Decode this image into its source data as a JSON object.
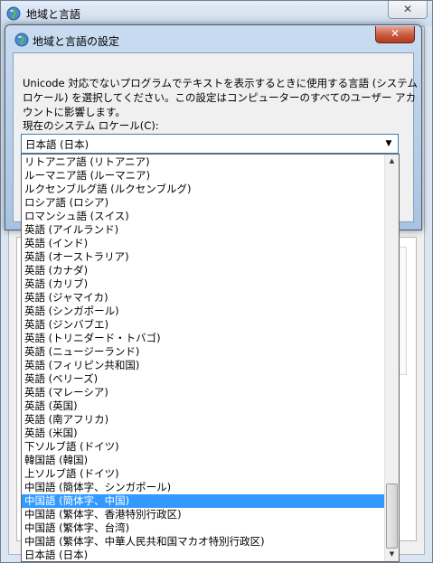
{
  "outer_window": {
    "title": "地域と言語",
    "close_label": "✕"
  },
  "dialog": {
    "title": "地域と言語の設定",
    "close_label": "✕",
    "description": "Unicode 対応でないプログラムでテキストを表示するときに使用する言語 (システム ロケール) を選択してください。この設定はコンピューターのすべてのユーザー アカウントに影響します。",
    "locale_label": "現在のシステム ロケール(C):",
    "selected_locale": "日本語 (日本)"
  },
  "dropdown": {
    "items": [
      "リトアニア語 (リトアニア)",
      "ルーマニア語 (ルーマニア)",
      "ルクセンブルグ語 (ルクセンブルグ)",
      "ロシア語 (ロシア)",
      "ロマンシュ語 (スイス)",
      "英語 (アイルランド)",
      "英語 (インド)",
      "英語 (オーストラリア)",
      "英語 (カナダ)",
      "英語 (カリブ)",
      "英語 (ジャマイカ)",
      "英語 (シンガポール)",
      "英語 (ジンバブエ)",
      "英語 (トリニダード・トバゴ)",
      "英語 (ニュージーランド)",
      "英語 (フィリピン共和国)",
      "英語 (ベリーズ)",
      "英語 (マレーシア)",
      "英語 (英国)",
      "英語 (南アフリカ)",
      "英語 (米国)",
      "下ソルブ語 (ドイツ)",
      "韓国語 (韓国)",
      "上ソルブ語 (ドイツ)",
      "中国語 (簡体字、シンガポール)",
      "中国語 (簡体字、中国)",
      "中国語 (繁体字、香港特別行政区)",
      "中国語 (繁体字、台湾)",
      "中国語 (繁体字、中華人民共和国マカオ特別行政区)",
      "日本語 (日本)"
    ],
    "highlighted_item": "中国語 (簡体字、中国)"
  },
  "colors": {
    "selection": "#3399ff",
    "close_button": "#c75a3f",
    "title_bar": "#c9dcf1"
  },
  "icons": {
    "window_icon": "globe-icon",
    "combo_arrow": "chevron-down-icon",
    "scroll_up": "arrow-up-icon",
    "scroll_down": "arrow-down-icon"
  }
}
